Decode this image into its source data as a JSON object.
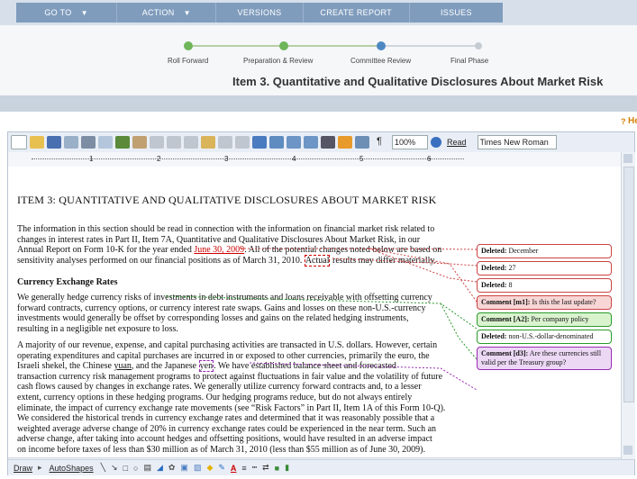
{
  "nav": {
    "items": [
      {
        "label": "GO TO",
        "caret": "▼"
      },
      {
        "label": "ACTION",
        "caret": "▼"
      },
      {
        "label": "VERSIONS",
        "caret": ""
      },
      {
        "label": "CREATE REPORT",
        "caret": ""
      },
      {
        "label": "ISSUES",
        "caret": ""
      }
    ]
  },
  "workflow": {
    "steps": [
      "Roll Forward",
      "Preparation & Review",
      "Committee Review",
      "Final Phase"
    ],
    "title": "Item 3. Quantitative and Qualitative Disclosures About Market Risk"
  },
  "help": {
    "label": "He"
  },
  "toolbar": {
    "zoom": "100%",
    "read_label": "Read",
    "font": "Times New Roman"
  },
  "ruler": {
    "numbers": [
      "1",
      "2",
      "3",
      "4",
      "5",
      "6"
    ]
  },
  "document": {
    "heading": "ITEM 3: QUANTITATIVE AND QUALITATIVE DISCLOSURES ABOUT MARKET RISK",
    "p1": {
      "line1": "The information in this section should be read in connection with the information on financial market risk related to",
      "line2": "changes in interest rates in Part II, Item 7A, Quantitative and Qualitative Disclosures About Market Risk, in our",
      "line3a": "Annual Report on Form 10-K for the year ended ",
      "line3_date": "June 30, 2009",
      "line3b": ". All of the potential changes noted below are based on",
      "line4a": "sensitivity analyses performed on our financial positions as of March 31, 2010. ",
      "line4_hl": "Actual",
      "line4b": " results may differ materially."
    },
    "subheading": "Currency Exchange Rates",
    "p2": {
      "line1": "We generally hedge currency risks of investments in debt instruments and loans receivable with offsetting currency",
      "line2": "forward contracts, currency options, or currency interest rate swaps. Gains and losses on these non-U.S.-currency",
      "line3": "investments would generally be offset by corresponding losses and gains on the related hedging instruments,",
      "line4": "resulting in a negligible net exposure to loss."
    },
    "p3": {
      "line1": "A majority of our revenue, expense, and capital purchasing activities are transacted in U.S. dollars. However, certain",
      "line2": "operating expenditures and capital purchases are incurred in or exposed to other currencies, primarily the euro, the",
      "line3a": "Israeli shekel, the Chinese ",
      "line3_yuan": "yuan",
      "line3b": ", and the Japanese ",
      "line3_yen": "yen",
      "line3c": ". We have established balance sheet and forecasted",
      "line4": "transaction currency risk management programs to protect against fluctuations in fair value and the volatility of future",
      "line5": "cash flows caused by changes in exchange rates. We generally utilize currency forward contracts and, to a lesser",
      "line6": "extent, currency options in these hedging programs. Our hedging programs reduce, but do not always entirely",
      "line7": "eliminate, the impact of currency exchange rate movements (see “Risk Factors” in Part II, Item 1A of this Form 10-Q).",
      "line8": "We considered the historical trends in currency exchange rates and determined that it was reasonably possible that a",
      "line9": "weighted average adverse change of 20% in currency exchange rates could be experienced in the near term. Such an",
      "line10": "adverse change, after taking into account hedges and offsetting positions, would have resulted in an adverse impact",
      "line11": "on income before taxes of less than $30 million as of March 31, 2010 (less than $55 million as of June 30, 2009)."
    }
  },
  "comments": [
    {
      "kind": "del",
      "label": "Deleted:",
      "text": " December"
    },
    {
      "kind": "del",
      "label": "Deleted:",
      "text": " 27"
    },
    {
      "kind": "del",
      "label": "Deleted:",
      "text": " 8"
    },
    {
      "kind": "red",
      "label": "Comment [m1]:",
      "text": " Is this the last update?"
    },
    {
      "kind": "green",
      "label": "Comment [A2]:",
      "text": " Per company policy"
    },
    {
      "kind": "green",
      "label": "Deleted:",
      "text": " non-U.S.-dollar-denominated"
    },
    {
      "kind": "purple",
      "label": "Comment [d3]:",
      "text": " Are these currencies still valid per the Treasury group?"
    }
  ],
  "drawbar": {
    "draw": "Draw",
    "autoshapes": "AutoShapes"
  }
}
